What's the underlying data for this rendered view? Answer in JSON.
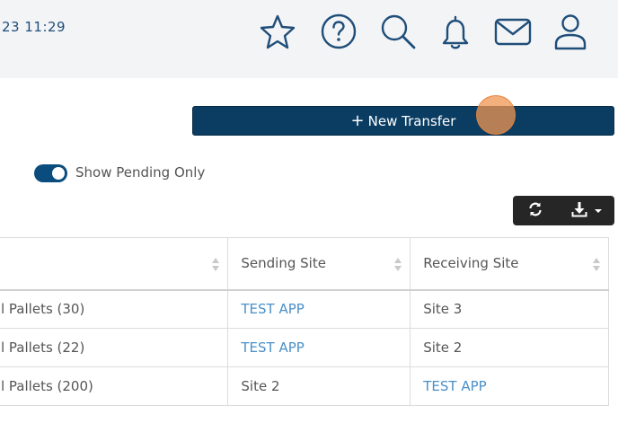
{
  "header": {
    "datetime": "23 11:29",
    "icons": [
      "star-icon",
      "help-icon",
      "search-icon",
      "bell-icon",
      "mail-icon",
      "user-icon"
    ],
    "icon_color": "#1f4e79"
  },
  "actions": {
    "new_transfer_plus": "+",
    "new_transfer_label": "New Transfer",
    "button_color": "#0b3d63"
  },
  "filter": {
    "show_pending_label": "Show Pending Only",
    "show_pending_enabled": true
  },
  "toolbar": {
    "icons": [
      "refresh-icon",
      "download-icon"
    ]
  },
  "table": {
    "headers": [
      "",
      "Sending Site",
      "Receiving Site"
    ],
    "rows": [
      {
        "description": "l Pallets (30)",
        "sending_site": "TEST APP",
        "sending_is_link": true,
        "receiving_site": "Site 3",
        "receiving_is_link": false
      },
      {
        "description": "l Pallets (22)",
        "sending_site": "TEST APP",
        "sending_is_link": true,
        "receiving_site": "Site 2",
        "receiving_is_link": false
      },
      {
        "description": "l Pallets (200)",
        "sending_site": "Site 2",
        "sending_is_link": false,
        "receiving_site": "TEST APP",
        "receiving_is_link": true
      }
    ],
    "link_color": "#4a90c8"
  }
}
